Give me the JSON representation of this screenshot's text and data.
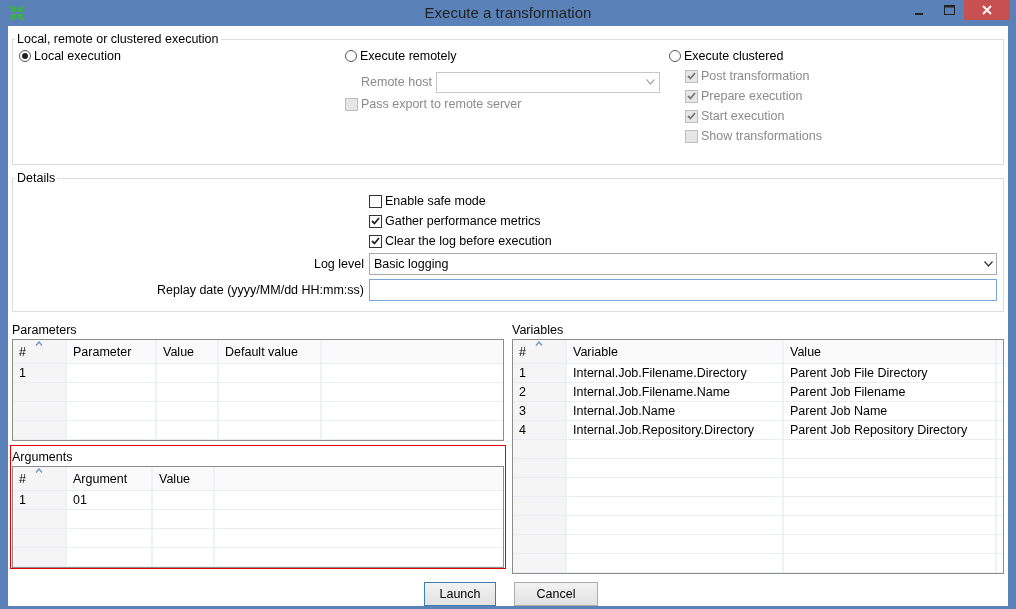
{
  "window": {
    "title": "Execute a transformation"
  },
  "execution": {
    "title": "Local, remote or clustered execution",
    "modes": [
      {
        "label": "Local execution",
        "selected": true
      },
      {
        "label": "Execute remotely",
        "selected": false
      },
      {
        "label": "Execute clustered",
        "selected": false
      }
    ],
    "remote_host": {
      "label": "Remote host",
      "disabled": true
    },
    "pass_export": {
      "label": "Pass export to remote server",
      "checked": false,
      "disabled": true
    },
    "cluster_options": [
      {
        "label": "Post transformation",
        "checked": true,
        "disabled": true
      },
      {
        "label": "Prepare execution",
        "checked": true,
        "disabled": true
      },
      {
        "label": "Start execution",
        "checked": true,
        "disabled": true
      },
      {
        "label": "Show transformations",
        "checked": false,
        "disabled": true
      }
    ]
  },
  "details": {
    "title": "Details",
    "options": [
      {
        "label": "Enable safe mode",
        "checked": false
      },
      {
        "label": "Gather performance metrics",
        "checked": true
      },
      {
        "label": "Clear the log before execution",
        "checked": true
      }
    ],
    "log_level": {
      "label": "Log level",
      "value": "Basic logging"
    },
    "replay_date": {
      "label": "Replay date (yyyy/MM/dd HH:mm:ss)"
    }
  },
  "parameters": {
    "title": "Parameters",
    "highlighted": false,
    "columns": [
      "#",
      "Parameter",
      "Value",
      "Default value"
    ],
    "rows": [
      [
        "1"
      ]
    ]
  },
  "arguments": {
    "title": "Arguments",
    "highlighted": true,
    "columns": [
      "#",
      "Argument",
      "Value"
    ],
    "rows": [
      [
        "1",
        "01"
      ]
    ]
  },
  "variables": {
    "title": "Variables",
    "columns": [
      "#",
      "Variable",
      "Value"
    ],
    "rows": [
      [
        "1",
        "Internal.Job.Filename.Directory",
        "Parent Job File Directory"
      ],
      [
        "2",
        "Internal.Job.Filename.Name",
        "Parent Job Filename"
      ],
      [
        "3",
        "Internal.Job.Name",
        "Parent Job Name"
      ],
      [
        "4",
        "Internal.Job.Repository.Directory",
        "Parent Job Repository Directory"
      ]
    ]
  },
  "buttons": [
    {
      "label": "Launch",
      "default": true
    },
    {
      "label": "Cancel",
      "default": false
    }
  ]
}
